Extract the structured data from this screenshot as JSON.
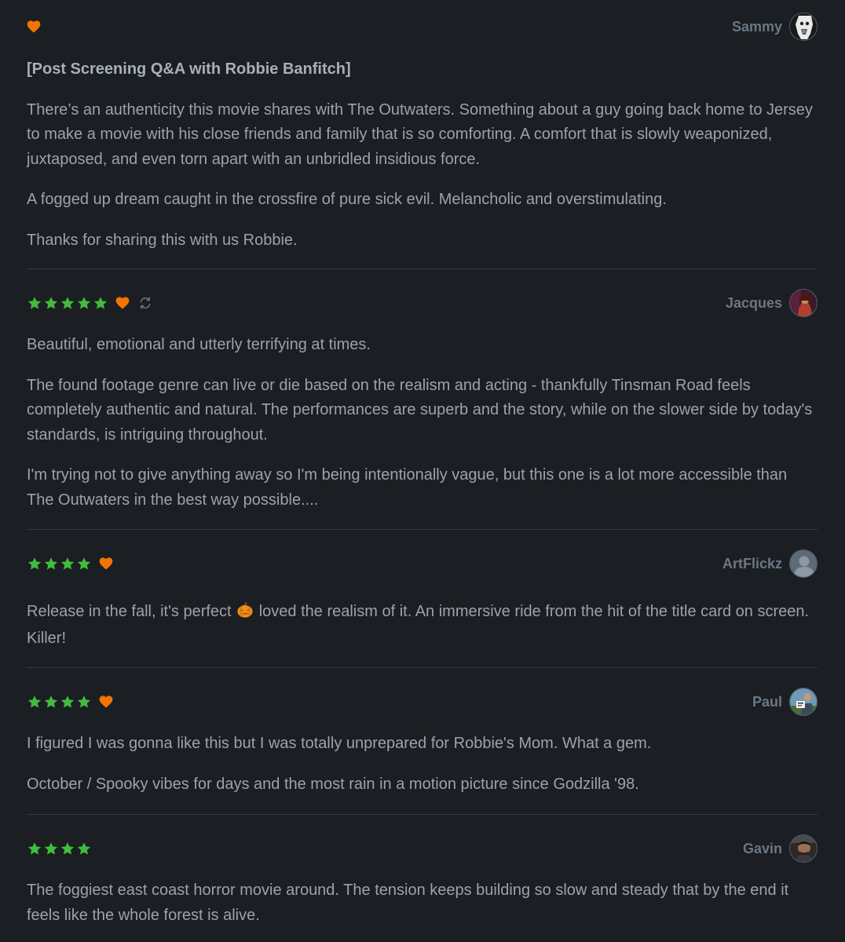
{
  "colors": {
    "background": "#1b1e22",
    "star": "#40bc3f",
    "heart": "#f27405",
    "username": "#6b7785",
    "text": "#9aa3ad",
    "divider": "#353b42"
  },
  "reviews": [
    {
      "author": "Sammy",
      "stars": 0,
      "liked": true,
      "rewatch": false,
      "paragraphs": [
        "[Post Screening Q&A with Robbie Banfitch]",
        "There’s an authenticity this movie shares with The Outwaters. Something about a guy going back home to Jersey to make a movie with his close friends and family that is so comforting. A comfort that is slowly weaponized, juxtaposed, and even torn apart with an unbridled insidious force.",
        "A fogged up dream caught in the crossfire of pure sick evil. Melancholic and overstimulating.",
        "Thanks for sharing this with us Robbie."
      ]
    },
    {
      "author": "Jacques",
      "stars": 5,
      "liked": true,
      "rewatch": true,
      "paragraphs": [
        "Beautiful, emotional and utterly terrifying at times.",
        "The found footage genre can live or die based on the realism and acting - thankfully Tinsman Road feels completely authentic and natural. The performances are superb and the story, while on the slower side by today's standards, is intriguing throughout.",
        "I'm trying not to give anything away so I'm being intentionally vague, but this one is a lot more accessible than The Outwaters in the best way possible...."
      ]
    },
    {
      "author": "ArtFlickz",
      "stars": 4,
      "liked": true,
      "rewatch": false,
      "text_before_emoji": "Release in the fall, it's perfect ",
      "emoji": "jack-o-lantern-emoji",
      "text_after_emoji": " loved the realism of it. An immersive ride from the hit of the title card on screen. Killer!"
    },
    {
      "author": "Paul",
      "stars": 4,
      "liked": true,
      "rewatch": false,
      "paragraphs": [
        "I figured I was gonna like this but I was totally unprepared for Robbie's Mom. What a gem.",
        "October / Spooky vibes for days and the most rain in a motion picture since Godzilla '98."
      ]
    },
    {
      "author": "Gavin",
      "stars": 4,
      "liked": false,
      "rewatch": false,
      "paragraphs": [
        "The foggiest east coast horror movie around. The tension keeps building so slow and steady that by the end it feels like the whole forest is alive."
      ]
    }
  ]
}
